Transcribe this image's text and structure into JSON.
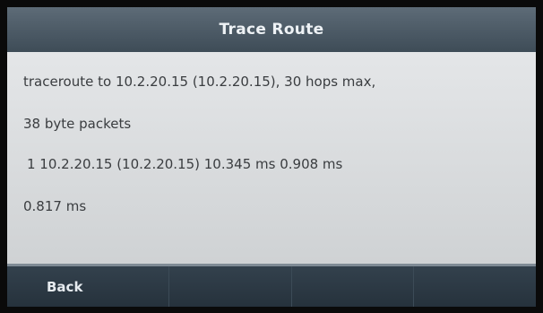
{
  "header": {
    "title": "Trace Route"
  },
  "output": {
    "lines": [
      "traceroute to 10.2.20.15 (10.2.20.15), 30 hops max,",
      "38 byte packets",
      "1  10.2.20.15 (10.2.20.15)  10.345 ms  0.908 ms",
      "0.817 ms"
    ]
  },
  "softkeys": [
    "Back",
    "",
    "",
    ""
  ]
}
